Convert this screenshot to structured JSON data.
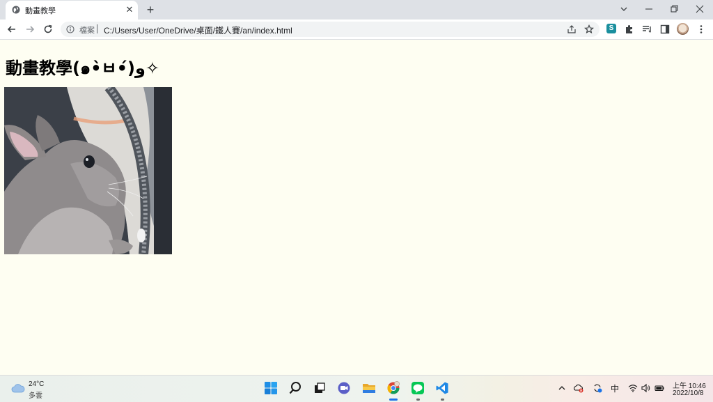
{
  "browser": {
    "tab": {
      "title": "動畫教學",
      "close_glyph": "✕"
    },
    "new_tab_glyph": "+",
    "omnibox": {
      "scheme_label": "檔案",
      "url": "C:/Users/User/OneDrive/桌面/鐵人賽/an/index.html"
    },
    "extensions": {
      "s_badge": "S"
    }
  },
  "page": {
    "heading": "動畫教學(๑•̀ㅂ•́)و✧"
  },
  "taskbar": {
    "weather": {
      "temp": "24°C",
      "condition": "多雲"
    },
    "tray": {
      "ime": "中"
    },
    "clock": {
      "time": "上午 10:46",
      "date": "2022/10/8"
    }
  },
  "colors": {
    "page_background": "#fefef2",
    "tab_strip": "#dee1e6",
    "accent": "#1a73e8"
  }
}
